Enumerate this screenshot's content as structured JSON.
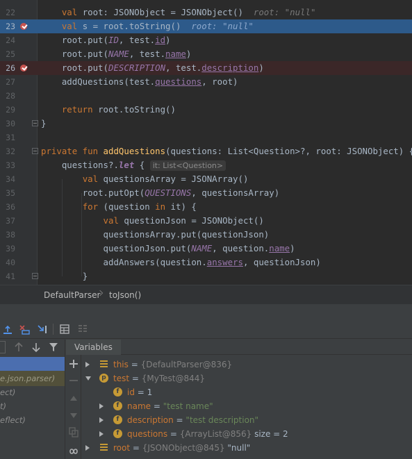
{
  "editor": {
    "lines": [
      {
        "n": "22",
        "tokens": [
          [
            "",
            "    "
          ],
          [
            "kw",
            "val "
          ],
          [
            "",
            "root: "
          ],
          [
            "ty",
            "JSONObject"
          ],
          [
            "",
            " = "
          ],
          [
            "",
            "JSONObject()  "
          ],
          [
            "inl",
            "root: \"null\""
          ]
        ]
      },
      {
        "n": "23",
        "tokens": [
          [
            "",
            "    "
          ],
          [
            "kw",
            "val "
          ],
          [
            "",
            "s = root.toString()  "
          ],
          [
            "inl-ex",
            "root: \"null\""
          ]
        ]
      },
      {
        "n": "24",
        "tokens": [
          [
            "",
            "    "
          ],
          [
            "",
            "root.put("
          ],
          [
            "cn",
            "ID"
          ],
          [
            "",
            ", test."
          ],
          [
            "pr ul",
            "id"
          ],
          [
            "",
            ")"
          ]
        ]
      },
      {
        "n": "25",
        "tokens": [
          [
            "",
            "    "
          ],
          [
            "",
            "root.put("
          ],
          [
            "cn",
            "NAME"
          ],
          [
            "",
            ", test."
          ],
          [
            "pr ul",
            "name"
          ],
          [
            "",
            ")"
          ]
        ]
      },
      {
        "n": "26",
        "tokens": [
          [
            "",
            "    "
          ],
          [
            "",
            "root.put("
          ],
          [
            "cn",
            "DESCRIPTION"
          ],
          [
            "",
            ", test."
          ],
          [
            "pr ul",
            "description"
          ],
          [
            "",
            ")"
          ]
        ]
      },
      {
        "n": "27",
        "tokens": [
          [
            "",
            "    "
          ],
          [
            "",
            "addQuestions(test."
          ],
          [
            "pr ul",
            "questions"
          ],
          [
            "",
            ", root)"
          ]
        ]
      },
      {
        "n": "28",
        "tokens": []
      },
      {
        "n": "29",
        "tokens": [
          [
            "",
            "    "
          ],
          [
            "kw",
            "return "
          ],
          [
            "",
            "root.toString()"
          ]
        ]
      },
      {
        "n": "30",
        "tokens": [
          [
            "",
            "}"
          ]
        ]
      },
      {
        "n": "31",
        "tokens": []
      },
      {
        "n": "32",
        "tokens": [
          [
            "kw",
            "private fun "
          ],
          [
            "fn",
            "addQuestions"
          ],
          [
            "",
            "(questions: List<Question>?, root: JSONObject) {"
          ]
        ]
      },
      {
        "n": "33",
        "tokens": [
          [
            "",
            "    "
          ],
          [
            "",
            "questions?."
          ],
          [
            "it",
            "let"
          ],
          [
            "",
            " { "
          ],
          [
            "hint",
            "it: List<Question>"
          ]
        ]
      },
      {
        "n": "34",
        "tokens": [
          [
            "",
            "        "
          ],
          [
            "kw",
            "val "
          ],
          [
            "",
            "questionsArray = JSONArray()"
          ]
        ]
      },
      {
        "n": "35",
        "tokens": [
          [
            "",
            "        "
          ],
          [
            "",
            "root.putOpt("
          ],
          [
            "cn",
            "QUESTIONS"
          ],
          [
            "",
            ", questionsArray)"
          ]
        ]
      },
      {
        "n": "36",
        "tokens": [
          [
            "",
            "        "
          ],
          [
            "kw",
            "for "
          ],
          [
            "",
            "(question "
          ],
          [
            "kw",
            "in "
          ],
          [
            "",
            "it) {"
          ]
        ]
      },
      {
        "n": "37",
        "tokens": [
          [
            "",
            "            "
          ],
          [
            "kw",
            "val "
          ],
          [
            "",
            "questionJson = JSONObject()"
          ]
        ]
      },
      {
        "n": "38",
        "tokens": [
          [
            "",
            "            "
          ],
          [
            "",
            "questionsArray.put(questionJson)"
          ]
        ]
      },
      {
        "n": "39",
        "tokens": [
          [
            "",
            "            "
          ],
          [
            "",
            "questionJson.put("
          ],
          [
            "cn",
            "NAME"
          ],
          [
            "",
            ", question."
          ],
          [
            "pr ul",
            "name"
          ],
          [
            "",
            ")"
          ]
        ]
      },
      {
        "n": "40",
        "tokens": [
          [
            "",
            "            "
          ],
          [
            "",
            "addAnswers(question."
          ],
          [
            "pr ul",
            "answers"
          ],
          [
            "",
            ", questionJson)"
          ]
        ]
      },
      {
        "n": "41",
        "tokens": [
          [
            "",
            "        "
          ],
          [
            "",
            "}"
          ]
        ]
      }
    ]
  },
  "breadcrumb": {
    "class_name": "DefaultParser",
    "method_name": "toJson()"
  },
  "debugger": {
    "frames": [
      {
        "label": "",
        "state": "sel"
      },
      {
        "label": "e.json.parser)",
        "state": "alt"
      },
      {
        "label": "ect)",
        "state": "normal"
      },
      {
        "label": "t)",
        "state": "normal"
      },
      {
        "label": "eflect)",
        "state": "normal"
      }
    ],
    "variables_tab": "Variables",
    "variables": [
      {
        "name": "this",
        "type": "{DefaultParser@836}",
        "value": "",
        "extra": "",
        "icon": "list",
        "expand": "r",
        "indent": 0
      },
      {
        "name": "test",
        "type": "{MyTest@844}",
        "value": "",
        "extra": "",
        "icon": "p",
        "expand": "d",
        "indent": 0
      },
      {
        "name": "id",
        "type": "",
        "value": "1",
        "extra": "",
        "icon": "f",
        "expand": "",
        "indent": 1
      },
      {
        "name": "name",
        "type": "",
        "value": "\"test name\"",
        "extra": "",
        "icon": "f",
        "expand": "r",
        "indent": 1
      },
      {
        "name": "description",
        "type": "",
        "value": "\"test description\"",
        "extra": "",
        "icon": "f",
        "expand": "r",
        "indent": 1
      },
      {
        "name": "questions",
        "type": "{ArrayList@856}",
        "value": "",
        "extra": "size = 2",
        "icon": "f",
        "expand": "r",
        "indent": 1
      },
      {
        "name": "root",
        "type": "{JSONObject@845}",
        "value": "\"null\"",
        "extra": "",
        "icon": "list",
        "expand": "r",
        "indent": 0
      }
    ]
  },
  "colors": {
    "execution_line": "#2D5A8A",
    "breakpoint_line": "#3B2728",
    "breakpoint": "#C75450"
  }
}
